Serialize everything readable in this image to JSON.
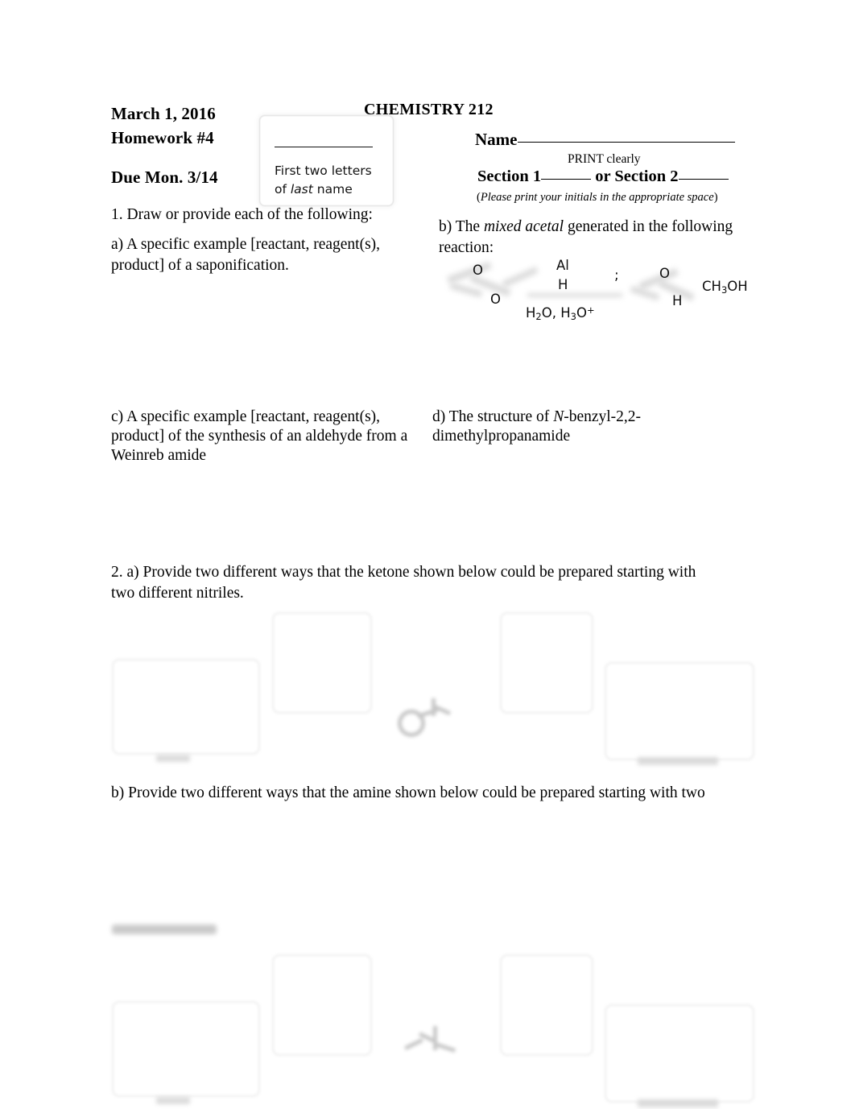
{
  "header": {
    "date": "March 1, 2016",
    "assignment": "Homework #4",
    "due": "Due Mon. 3/14",
    "course_title": "CHEMISTRY 212",
    "name_label": "Name",
    "print_clearly": "PRINT clearly",
    "section_1_label": "Section 1",
    "section_or": " or Section 2",
    "please_print_note": "Please print your initials in the appropriate space",
    "initials_caption_line1": "First two letters",
    "initials_caption_line2_pre": "of ",
    "initials_caption_line2_em": "last",
    "initials_caption_line2_post": " name"
  },
  "question1": {
    "stem": "1. Draw or provide each of the following:",
    "part_a": "a) A specific example [reactant, reagent(s), product] of a saponification.",
    "part_b_pre": "b) The ",
    "part_b_em": "mixed acetal",
    "part_b_post": " generated in the following reaction:",
    "part_c": "c) A specific example [reactant, reagent(s), product] of the synthesis of an aldehyde from a Weinreb amide",
    "part_d_pre": "d) The structure of ",
    "part_d_em": "N",
    "part_d_post": "-benzyl-2,2-dimethylpropanamide"
  },
  "reaction": {
    "atom_o_top_left": "O",
    "atom_o_bottom_left": "O",
    "reagent_al": "Al",
    "reagent_h": "H",
    "conditions_h2o": "H",
    "conditions_h2o_sub": "2",
    "conditions_h2o_rest": "O, H",
    "conditions_h3o_sub": "3",
    "conditions_h3o_rest": "O",
    "conditions_charge": "+",
    "separator": ";",
    "atom_o_right": "O",
    "atom_h_right": "H",
    "methanol_pre": "CH",
    "methanol_sub": "3",
    "methanol_post": "OH"
  },
  "question2": {
    "part_a": "2. a) Provide two different ways that the ketone shown below could be prepared starting with two different nitriles.",
    "part_b": "b) Provide two different ways that the amine shown below could be prepared starting with two"
  },
  "colors": {
    "text": "#000000",
    "faint_box_border": "#ededed",
    "ghost_gray": "#d6d6d6",
    "page_background": "#ffffff"
  }
}
